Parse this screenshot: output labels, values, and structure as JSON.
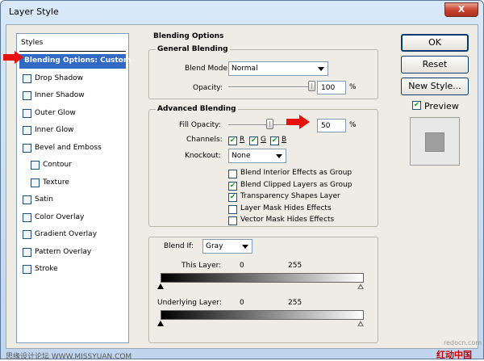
{
  "window": {
    "title": "Layer Style",
    "close_label": "X"
  },
  "styles": {
    "header": "Styles",
    "items": [
      {
        "label": "Blending Options: Custom",
        "checkbox": false,
        "selected": true,
        "indent": false
      },
      {
        "label": "Drop Shadow",
        "checkbox": true,
        "checked": false,
        "indent": false
      },
      {
        "label": "Inner Shadow",
        "checkbox": true,
        "checked": false,
        "indent": false
      },
      {
        "label": "Outer Glow",
        "checkbox": true,
        "checked": false,
        "indent": false
      },
      {
        "label": "Inner Glow",
        "checkbox": true,
        "checked": false,
        "indent": false
      },
      {
        "label": "Bevel and Emboss",
        "checkbox": true,
        "checked": false,
        "indent": false
      },
      {
        "label": "Contour",
        "checkbox": true,
        "checked": false,
        "indent": true
      },
      {
        "label": "Texture",
        "checkbox": true,
        "checked": false,
        "indent": true
      },
      {
        "label": "Satin",
        "checkbox": true,
        "checked": false,
        "indent": false
      },
      {
        "label": "Color Overlay",
        "checkbox": true,
        "checked": false,
        "indent": false
      },
      {
        "label": "Gradient Overlay",
        "checkbox": true,
        "checked": false,
        "indent": false
      },
      {
        "label": "Pattern Overlay",
        "checkbox": true,
        "checked": false,
        "indent": false
      },
      {
        "label": "Stroke",
        "checkbox": true,
        "checked": false,
        "indent": false
      }
    ]
  },
  "blending_options": {
    "title": "Blending Options",
    "general": {
      "title": "General Blending",
      "blend_mode_label": "Blend Mode:",
      "blend_mode_value": "Normal",
      "opacity_label": "Opacity:",
      "opacity_value": "100",
      "opacity_percent": 100,
      "opacity_unit": "%"
    },
    "advanced": {
      "title": "Advanced Blending",
      "fill_opacity_label": "Fill Opacity:",
      "fill_opacity_value": "50",
      "fill_opacity_percent": 50,
      "fill_opacity_unit": "%",
      "channels_label": "Channels:",
      "channels": [
        {
          "label": "R",
          "checked": true
        },
        {
          "label": "G",
          "checked": true
        },
        {
          "label": "B",
          "checked": true
        }
      ],
      "knockout_label": "Knockout:",
      "knockout_value": "None",
      "options": [
        {
          "label": "Blend Interior Effects as Group",
          "checked": false
        },
        {
          "label": "Blend Clipped Layers as Group",
          "checked": true
        },
        {
          "label": "Transparency Shapes Layer",
          "checked": true
        },
        {
          "label": "Layer Mask Hides Effects",
          "checked": false
        },
        {
          "label": "Vector Mask Hides Effects",
          "checked": false
        }
      ]
    },
    "blend_if": {
      "label": "Blend If:",
      "value": "Gray",
      "this_layer_label": "This Layer:",
      "this_layer_min": "0",
      "this_layer_max": "255",
      "underlying_label": "Underlying Layer:",
      "underlying_min": "0",
      "underlying_max": "255"
    }
  },
  "buttons": {
    "ok": "OK",
    "reset": "Reset",
    "new_style": "New Style...",
    "preview_label": "Preview",
    "preview_checked": true
  },
  "watermark": {
    "left": "思缘设计论坛 WWW.MISSYUAN.COM",
    "right_top": "redocn.com",
    "right_bottom": "红动中国"
  },
  "colors": {
    "selection": "#316ac5",
    "arrow": "#e8120c",
    "check": "#21a121"
  }
}
